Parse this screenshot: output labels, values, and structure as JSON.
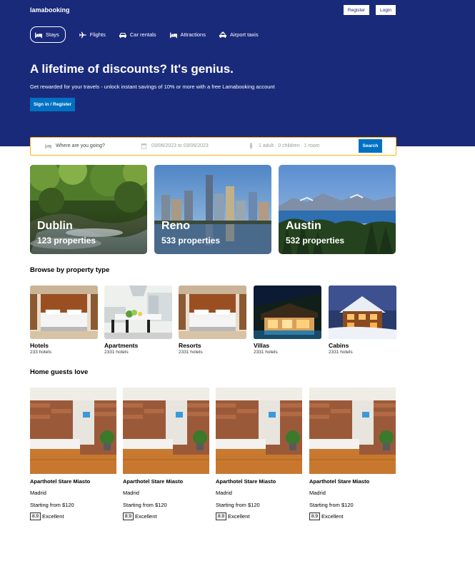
{
  "header": {
    "logo": "lamabooking",
    "register_label": "Register",
    "login_label": "Login",
    "tabs": [
      {
        "label": "Stays",
        "icon": "bed-icon",
        "active": true
      },
      {
        "label": "Flights",
        "icon": "plane-icon"
      },
      {
        "label": "Car rentals",
        "icon": "car-icon"
      },
      {
        "label": "Attractions",
        "icon": "bed-icon"
      },
      {
        "label": "Airport taxis",
        "icon": "taxi-icon"
      }
    ],
    "title": "A lifetime of discounts? It's genius.",
    "description": "Get rewarded for your travels - unlock instant savings of 10% or more with a free Lamabooking account",
    "signin_label": "Sign in / Register"
  },
  "search": {
    "destination_placeholder": "Where are you going?",
    "dates": "03/06/2023 to 03/06/2023",
    "guests": "1 adult · 0 children · 1 room",
    "button_label": "Search"
  },
  "featured": [
    {
      "name": "Dublin",
      "count": "123 properties"
    },
    {
      "name": "Reno",
      "count": "533 properties"
    },
    {
      "name": "Austin",
      "count": "532 properties"
    }
  ],
  "property_types": {
    "title": "Browse by property type",
    "items": [
      {
        "name": "Hotels",
        "count": "233 hotels"
      },
      {
        "name": "Apartments",
        "count": "2331 hotels"
      },
      {
        "name": "Resorts",
        "count": "2331 hotels"
      },
      {
        "name": "Villas",
        "count": "2331 hotels"
      },
      {
        "name": "Cabins",
        "count": "2331 hotels"
      }
    ]
  },
  "guests_love": {
    "title": "Home guests love",
    "items": [
      {
        "name": "Aparthotel Stare Miasto",
        "city": "Madrid",
        "price": "Starting from $120",
        "score": "8.9",
        "rating": "Excellent"
      },
      {
        "name": "Aparthotel Stare Miasto",
        "city": "Madrid",
        "price": "Starting from $120",
        "score": "8.9",
        "rating": "Excellent"
      },
      {
        "name": "Aparthotel Stare Miasto",
        "city": "Madrid",
        "price": "Starting from $120",
        "score": "8.9",
        "rating": "Excellent"
      },
      {
        "name": "Aparthotel Stare Miasto",
        "city": "Madrid",
        "price": "Starting from $120",
        "score": "8.9",
        "rating": "Excellent"
      }
    ]
  },
  "colors": {
    "header_bg": "#1a2a7a",
    "primary_button": "#0071c2",
    "search_border": "#febb02"
  }
}
